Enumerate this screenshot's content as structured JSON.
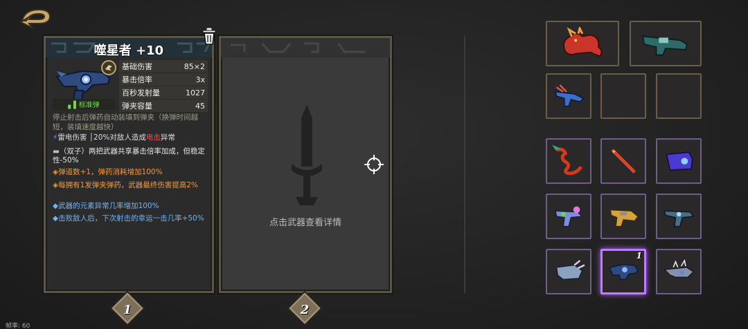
{
  "weapon": {
    "name": "噬星者 +10",
    "ammo_type": "标准弹",
    "stats": [
      {
        "label": "基础伤害",
        "value": "85×2"
      },
      {
        "label": "暴击倍率",
        "value": "3x"
      },
      {
        "label": "百秒发射量",
        "value": "1027"
      },
      {
        "label": "弹夹容量",
        "value": "45"
      }
    ],
    "reload_desc": "停止射击后弹药自动装填到弹夹（换弹时间越短，装填速度越快）",
    "element_label": "雷电伤害",
    "element_effect_prefix": "│20%对敌人造成",
    "element_effect_highlight": "电击",
    "element_effect_suffix": "异常",
    "traits": {
      "dual": "（双子）两把武器共享暴击倍率加成，但稳定性-50%",
      "orange1": "◈弹道数+1，弹药消耗增加100%",
      "orange2": "◈每拥有1发弹夹弹药，武器最终伤害提高2%",
      "blue1": "◆武器的元素异常几率增加100%",
      "blue2": "◆击败敌人后，下次射击的幸运一击几率+50%"
    },
    "colors": {
      "orange": "#f3983a",
      "blue": "#6eb4f5",
      "green": "#6fdc4f",
      "red": "#ff4a4a"
    }
  },
  "second_card": {
    "hint": "点击武器查看详情"
  },
  "slot_tabs": [
    "1",
    "2"
  ],
  "fps_label": "帧率: 60",
  "equipped": [
    {
      "icon": "red-dragon-pet-icon"
    },
    {
      "icon": "teal-launcher-icon"
    },
    {
      "icon": "blue-trident-gun-icon"
    },
    {
      "icon": "empty-slot"
    },
    {
      "icon": "empty-slot"
    }
  ],
  "inventory": [
    {
      "icon": "dragon-whip-icon"
    },
    {
      "icon": "flame-spear-icon"
    },
    {
      "icon": "purple-cannon-icon"
    },
    {
      "icon": "neon-pistol-icon"
    },
    {
      "icon": "gold-blaster-icon"
    },
    {
      "icon": "steel-rifle-icon"
    },
    {
      "icon": "claw-gauntlet-icon"
    },
    {
      "icon": "star-devourer-icon",
      "count": "1",
      "selected": true
    },
    {
      "icon": "spiked-launcher-icon"
    }
  ]
}
